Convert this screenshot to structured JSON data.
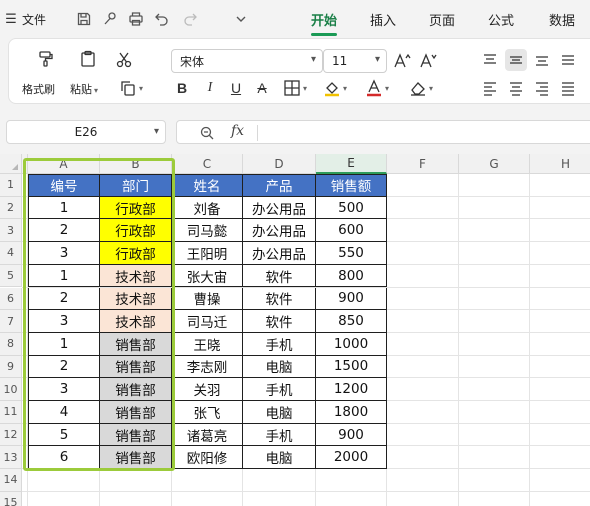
{
  "menu": {
    "label": "文件"
  },
  "quick_access_icons": [
    "save-icon",
    "brush-icon",
    "print-icon",
    "undo-icon",
    "redo-icon",
    "dropdown-icon"
  ],
  "tabs": [
    {
      "label": "开始",
      "active": true
    },
    {
      "label": "插入",
      "active": false
    },
    {
      "label": "页面",
      "active": false
    },
    {
      "label": "公式",
      "active": false
    },
    {
      "label": "数据",
      "active": false
    }
  ],
  "ribbon": {
    "format_painter": "格式刷",
    "paste": "粘贴",
    "font_name": "宋体",
    "font_size": "11"
  },
  "name_box": "E26",
  "fx_label": "fx",
  "columns": [
    "A",
    "B",
    "C",
    "D",
    "E",
    "F",
    "G",
    "H"
  ],
  "rows": [
    "1",
    "2",
    "3",
    "4",
    "5",
    "6",
    "7",
    "8",
    "9",
    "10",
    "11",
    "12",
    "13",
    "14",
    "15"
  ],
  "table": {
    "headers": [
      "编号",
      "部门",
      "姓名",
      "产品",
      "销售额"
    ],
    "rows": [
      [
        "1",
        "行政部",
        "刘备",
        "办公用品",
        "500"
      ],
      [
        "2",
        "行政部",
        "司马懿",
        "办公用品",
        "600"
      ],
      [
        "3",
        "行政部",
        "王阳明",
        "办公用品",
        "550"
      ],
      [
        "1",
        "技术部",
        "张大宙",
        "软件",
        "800"
      ],
      [
        "2",
        "技术部",
        "曹操",
        "软件",
        "900"
      ],
      [
        "3",
        "技术部",
        "司马迁",
        "软件",
        "850"
      ],
      [
        "1",
        "销售部",
        "王晓",
        "手机",
        "1000"
      ],
      [
        "2",
        "销售部",
        "李志刚",
        "电脑",
        "1500"
      ],
      [
        "3",
        "销售部",
        "关羽",
        "手机",
        "1200"
      ],
      [
        "4",
        "销售部",
        "张飞",
        "电脑",
        "1800"
      ],
      [
        "5",
        "销售部",
        "诸葛亮",
        "手机",
        "900"
      ],
      [
        "6",
        "销售部",
        "欧阳修",
        "电脑",
        "2000"
      ]
    ]
  },
  "colors": {
    "header_fill": "#4472c4",
    "admin_fill": "#ffff00",
    "tech_fill": "#fbe5d6",
    "sales_fill": "#d9d9d9",
    "selection_border": "#9ccb3b",
    "active_tab": "#1a7f47"
  }
}
